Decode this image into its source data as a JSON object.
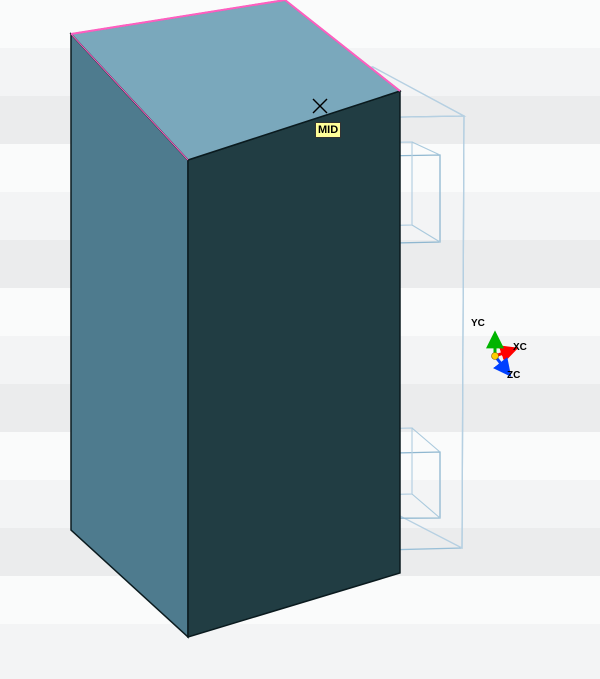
{
  "snap": {
    "label": "MID"
  },
  "triad": {
    "x_label": "XC",
    "y_label": "YC",
    "z_label": "ZC"
  },
  "colors": {
    "band_light": "#fbfbfb",
    "band_mid": "#f3f4f5",
    "band_dark": "#ebeced",
    "box_top": "#79a7bb",
    "box_left": "#4e7b8e",
    "box_front": "#1f3f44",
    "edge": "#0a1a1e",
    "wire": "#8fb7d0",
    "wire_dark": "#5a90b2",
    "wire_light": "#c6ddec",
    "highlight": "#ff6ec7",
    "axis_x": "#ff0000",
    "axis_y": "#00b400",
    "axis_z": "#0040ff"
  }
}
